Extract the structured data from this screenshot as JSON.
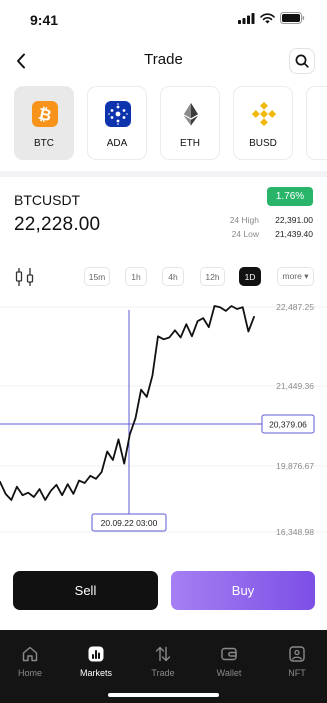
{
  "status_bar": {
    "time": "9:41"
  },
  "header": {
    "title": "Trade"
  },
  "coins": [
    {
      "label": "BTC",
      "icon": "bitcoin-icon",
      "selected": true,
      "color": "#f7931a"
    },
    {
      "label": "ADA",
      "icon": "cardano-icon",
      "selected": false,
      "color": "#0d33ad"
    },
    {
      "label": "ETH",
      "icon": "ethereum-icon",
      "selected": false,
      "color": "#3c3c3d"
    },
    {
      "label": "BUSD",
      "icon": "binance-icon",
      "selected": false,
      "color": "#f0b90b"
    }
  ],
  "ticker": {
    "pair": "BTCUSDT",
    "price": "22,228.00",
    "change": "1.76%",
    "high_label": "24 High",
    "high_value": "22,391.00",
    "low_label": "24 Low",
    "low_value": "21,439.40"
  },
  "timeframes": [
    "15m",
    "1h",
    "4h",
    "12h",
    "1D",
    "more ▾"
  ],
  "active_timeframe": "1D",
  "chart_data": {
    "type": "line",
    "y_ticks": [
      "22,487.25",
      "21,449.36",
      "19,876.67",
      "16,348.98"
    ],
    "crosshair": {
      "y_label": "20,379.06",
      "x_label": "20.09.22 03:00"
    },
    "values": [
      19600,
      19400,
      19300,
      19520,
      19380,
      19420,
      19350,
      19480,
      19300,
      19450,
      19550,
      19380,
      19560,
      19400,
      19620,
      19580,
      19700,
      19650,
      19760,
      20100,
      19960,
      20300,
      19900,
      20380,
      20650,
      21120,
      21000,
      21350,
      22000,
      21950,
      21980,
      22100,
      21980,
      22200,
      22000,
      22250,
      22300,
      22150,
      22500,
      22480,
      22420,
      22500,
      22450,
      22480,
      22080,
      22320
    ]
  },
  "actions": {
    "sell_label": "Sell",
    "buy_label": "Buy"
  },
  "tabs": [
    {
      "label": "Home",
      "icon": "home-icon",
      "active": false
    },
    {
      "label": "Markets",
      "icon": "markets-icon",
      "active": true
    },
    {
      "label": "Trade",
      "icon": "trade-arrows-icon",
      "active": false
    },
    {
      "label": "Wallet",
      "icon": "wallet-icon",
      "active": false
    },
    {
      "label": "NFT",
      "icon": "nft-image-icon",
      "active": false
    }
  ]
}
